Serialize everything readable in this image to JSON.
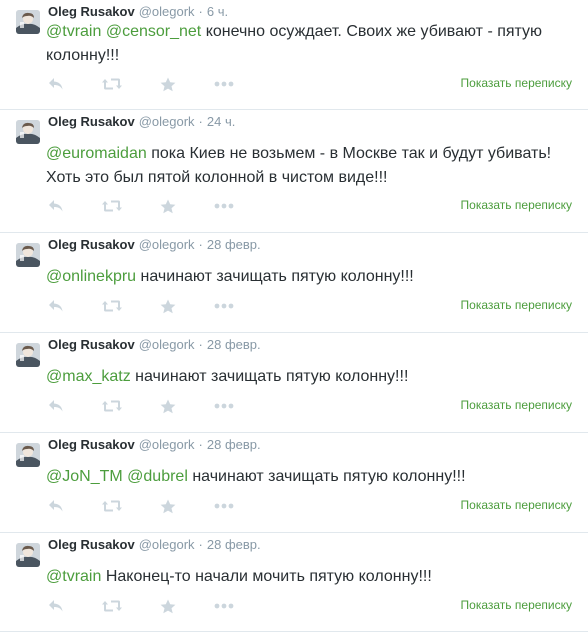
{
  "timeline": {
    "tweets": [
      {
        "fullname": "Oleg Rusakov",
        "username": "@olegork",
        "separator": "·",
        "time": "6 ч.",
        "mentions": [
          "@tvrain",
          "@censor_net"
        ],
        "text": "конечно осуждает. Своих же убивают - пятую колонну!!!",
        "conversation_link": "Показать переписку"
      },
      {
        "fullname": "Oleg Rusakov",
        "username": "@olegork",
        "separator": "·",
        "time": "24 ч.",
        "mentions": [
          "@euromaidan"
        ],
        "text": "пока Киев не возьмем - в Москве так и будут убивать! Хоть это был пятой колонной в чистом виде!!!",
        "conversation_link": "Показать переписку"
      },
      {
        "fullname": "Oleg Rusakov",
        "username": "@olegork",
        "separator": "·",
        "time": "28 февр.",
        "mentions": [
          "@onlinekpru"
        ],
        "text": "начинают зачищать пятую колонну!!!",
        "conversation_link": "Показать переписку"
      },
      {
        "fullname": "Oleg Rusakov",
        "username": "@olegork",
        "separator": "·",
        "time": "28 февр.",
        "mentions": [
          "@max_katz"
        ],
        "text": "начинают зачищать пятую колонну!!!",
        "conversation_link": "Показать переписку"
      },
      {
        "fullname": "Oleg Rusakov",
        "username": "@olegork",
        "separator": "·",
        "time": "28 февр.",
        "mentions": [
          "@JoN_TM",
          "@dubrel"
        ],
        "text": "начинают зачищать пятую колонну!!!",
        "conversation_link": "Показать переписку"
      },
      {
        "fullname": "Oleg Rusakov",
        "username": "@olegork",
        "separator": "·",
        "time": "28 февр.",
        "mentions": [
          "@tvrain"
        ],
        "text": "Наконец-то начали мочить пятую колонну!!!",
        "conversation_link": "Показать переписку"
      }
    ],
    "action_icons": [
      "reply-icon",
      "retweet-icon",
      "favorite-icon",
      "more-icon"
    ]
  },
  "colors": {
    "link": "#4c9d3d",
    "text": "#292f33",
    "meta": "#8899a6",
    "action_icon": "#ccd6dd",
    "border": "#e1e8ed"
  }
}
